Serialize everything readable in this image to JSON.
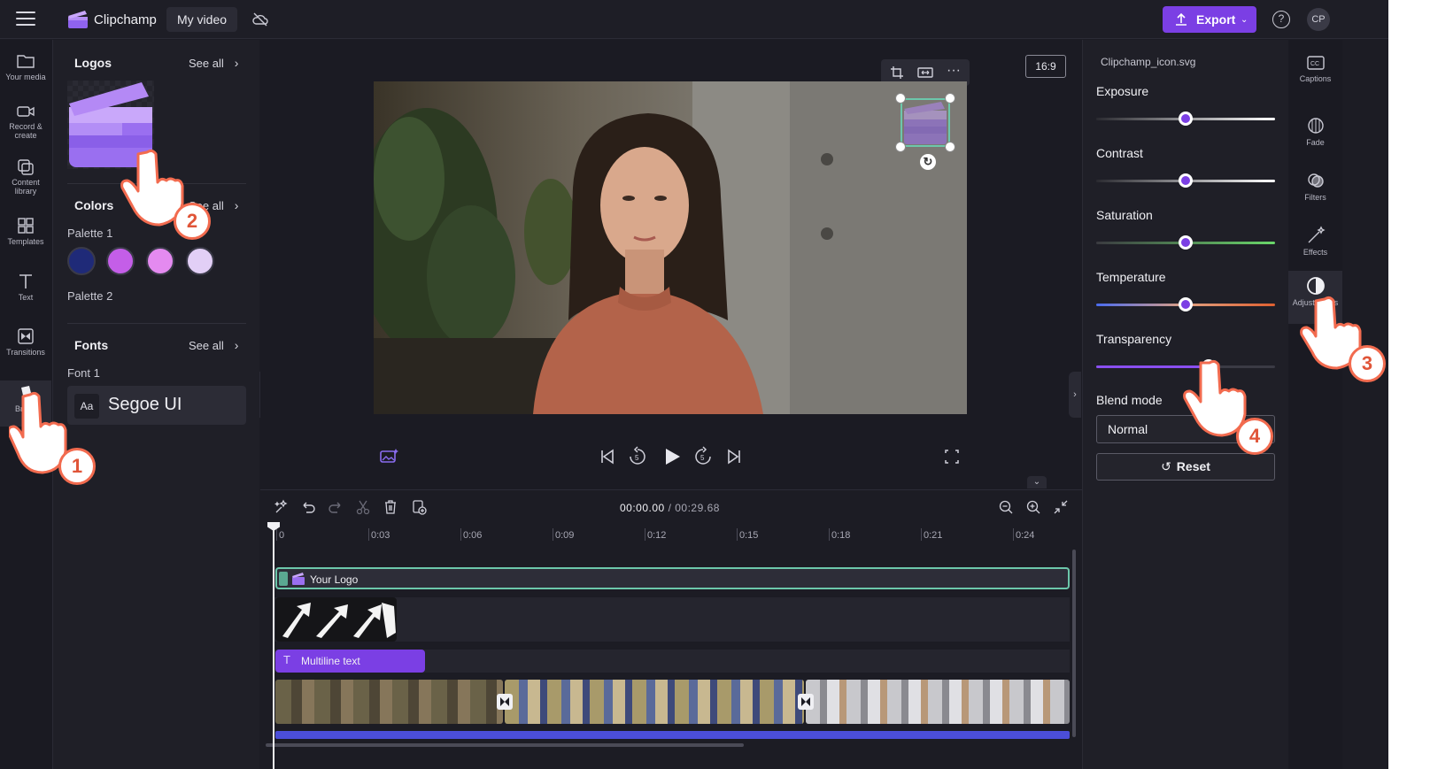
{
  "app": {
    "name": "Clipchamp",
    "video_title": "My video"
  },
  "header": {
    "export_label": "Export",
    "help_label": "?",
    "avatar_initials": "CP"
  },
  "left_rail": [
    {
      "label": "Your media",
      "icon": "folder-icon"
    },
    {
      "label": "Record & create",
      "icon": "camera-icon"
    },
    {
      "label": "Content library",
      "icon": "library-icon"
    },
    {
      "label": "Templates",
      "icon": "templates-icon"
    },
    {
      "label": "Text",
      "icon": "text-icon"
    },
    {
      "label": "Transitions",
      "icon": "transitions-icon"
    },
    {
      "label": "Brand",
      "icon": "brand-kit-icon"
    }
  ],
  "brand_panel": {
    "logos": {
      "title": "Logos",
      "see_all": "See all"
    },
    "colors": {
      "title": "Colors",
      "see_all": "See all",
      "palette1": "Palette 1",
      "palette2": "Palette 2",
      "swatches": [
        "#1f2a78",
        "#c45ee8",
        "#e48af0",
        "#e2cff6"
      ]
    },
    "fonts": {
      "title": "Fonts",
      "see_all": "See all",
      "font1_label": "Font 1",
      "font_preview": "Aa",
      "font_name": "Segoe UI"
    }
  },
  "preview": {
    "aspect_ratio": "16:9"
  },
  "right_panel": {
    "file_name": "Clipchamp_icon.svg",
    "sliders": [
      {
        "label": "Exposure",
        "value": 0.5
      },
      {
        "label": "Contrast",
        "value": 0.5
      },
      {
        "label": "Saturation",
        "value": 0.5
      },
      {
        "label": "Temperature",
        "value": 0.5
      },
      {
        "label": "Transparency",
        "value": 0.63
      }
    ],
    "blend_mode_label": "Blend mode",
    "blend_mode_value": "Normal",
    "reset_label": "Reset"
  },
  "right_rail": [
    {
      "label": "Captions",
      "icon": "captions-icon"
    },
    {
      "label": "Fade",
      "icon": "fade-icon"
    },
    {
      "label": "Filters",
      "icon": "filters-icon"
    },
    {
      "label": "Effects",
      "icon": "effects-icon"
    },
    {
      "label": "Adjust colors",
      "icon": "adjust-colors-icon"
    }
  ],
  "timeline": {
    "current_time": "00:00.00",
    "duration": "/ 00:29.68",
    "ticks": [
      "0",
      "0:03",
      "0:06",
      "0:09",
      "0:12",
      "0:15",
      "0:18",
      "0:21",
      "0:24"
    ],
    "logo_track_label": "Your Logo",
    "text_clip_label": "Multiline text"
  },
  "callouts": [
    "1",
    "2",
    "3",
    "4"
  ],
  "colors": {
    "accent": "#7b3fe4",
    "logo_clip_border": "#6cc7ab",
    "callout": "#f26b4f"
  }
}
